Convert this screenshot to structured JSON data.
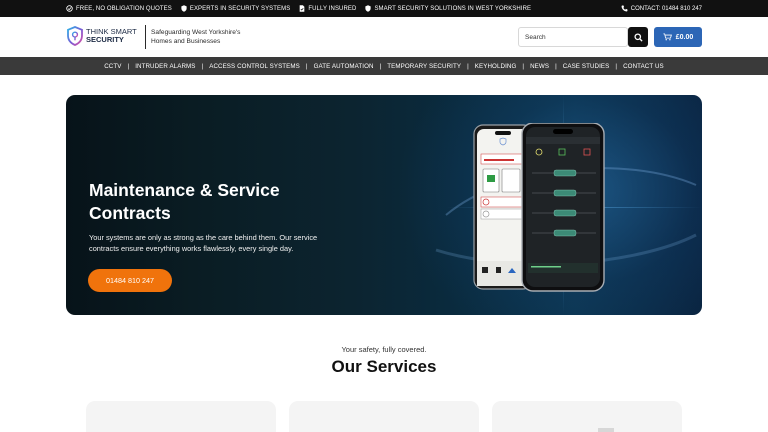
{
  "topbar": {
    "features": [
      {
        "icon": "check-circle-icon",
        "label": "FREE, NO OBLIGATION QUOTES"
      },
      {
        "icon": "shield-icon",
        "label": "EXPERTS IN SECURITY SYSTEMS"
      },
      {
        "icon": "document-check-icon",
        "label": "FULLY INSURED"
      },
      {
        "icon": "shield-icon",
        "label": "SMART SECURITY SOLUTIONS IN WEST YORKSHIRE"
      }
    ],
    "contact": "CONTACT: 01484 810 247"
  },
  "header": {
    "logo_line1": "THINK SMART",
    "logo_line2": "SECURITY",
    "tagline": "Safeguarding West Yorkshire's Homes and Businesses",
    "search_placeholder": "Search",
    "cart_total": "£0.00"
  },
  "nav": [
    "CCTV",
    "INTRUDER ALARMS",
    "ACCESS CONTROL SYSTEMS",
    "GATE AUTOMATION",
    "TEMPORARY SECURITY",
    "KEYHOLDING",
    "NEWS",
    "CASE STUDIES",
    "CONTACT US"
  ],
  "hero": {
    "title_line1": "Maintenance & Service",
    "title_line2": "Contracts",
    "text": "Your systems are only as strong as the care behind them. Our service contracts ensure everything works flawlessly, every single day.",
    "cta": "01484 810 247"
  },
  "services": {
    "kicker": "Your safety, fully covered.",
    "title": "Our Services"
  },
  "colors": {
    "topbar": "#111111",
    "nav": "#3a3a3a",
    "cart": "#2c66b6",
    "cta": "#f0730c"
  }
}
